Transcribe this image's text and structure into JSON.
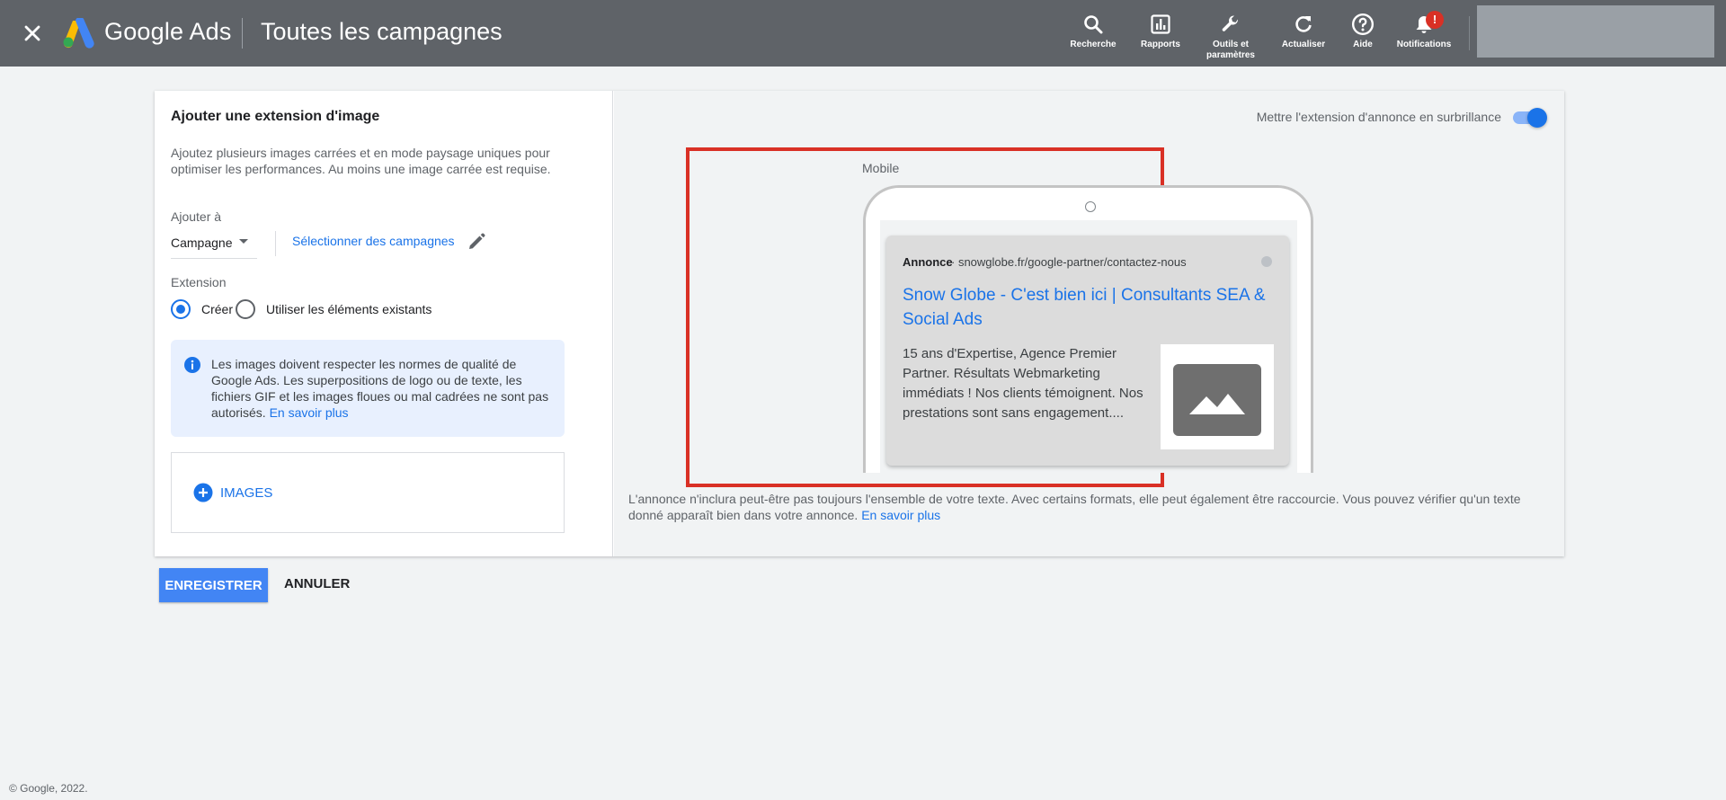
{
  "topbar": {
    "brand": "Google Ads",
    "title": "Toutes les campagnes",
    "tools": [
      {
        "label": "Recherche",
        "icon": "search-icon"
      },
      {
        "label": "Rapports",
        "icon": "reports-icon"
      },
      {
        "label": "Outils et paramètres",
        "icon": "wrench-icon"
      },
      {
        "label": "Actualiser",
        "icon": "refresh-icon"
      },
      {
        "label": "Aide",
        "icon": "help-icon"
      },
      {
        "label": "Notifications",
        "icon": "bell-icon",
        "badge": "!"
      }
    ]
  },
  "panel": {
    "title": "Ajouter une extension d'image",
    "description": "Ajoutez plusieurs images carrées et en mode paysage uniques pour optimiser les performances. Au moins une image carrée est requise.",
    "add_to_label": "Ajouter à",
    "add_to_value": "Campagne",
    "select_campaigns": "Sélectionner des campagnes",
    "extension_label": "Extension",
    "radio_create": "Créer",
    "radio_existing": "Utiliser les éléments existants",
    "info_text": "Les images doivent respecter les normes de qualité de Google Ads. Les superpositions de logo ou de texte, les fichiers GIF et les images floues ou mal cadrées ne sont pas autorisés.",
    "info_link": "En savoir plus",
    "images_button": "IMAGES"
  },
  "preview": {
    "highlight_label": "Mettre l'extension d'annonce en surbrillance",
    "highlight_on": true,
    "device_label": "Mobile",
    "ad": {
      "badge": "Annonce",
      "url": "· snowglobe.fr/google-partner/contactez-nous",
      "title": "Snow Globe - C'est bien ici | Consultants SEA & Social Ads",
      "body": "15 ans d'Expertise, Agence Premier Partner. Résultats Webmarketing immédiats ! Nos clients témoignent. Nos prestations sont sans engagement...."
    },
    "disclaimer": "L'annonce n'inclura peut-être pas toujours l'ensemble de votre texte. Avec certains formats, elle peut également être raccourcie. Vous pouvez vérifier qu'un texte donné apparaît bien dans votre annonce.",
    "disclaimer_link": "En savoir plus"
  },
  "actions": {
    "save": "ENREGISTRER",
    "cancel": "ANNULER"
  },
  "footer": "© Google, 2022.",
  "colors": {
    "topbar": "#5f6368",
    "accent": "#1a73e8",
    "highlight_frame": "#d93025"
  }
}
